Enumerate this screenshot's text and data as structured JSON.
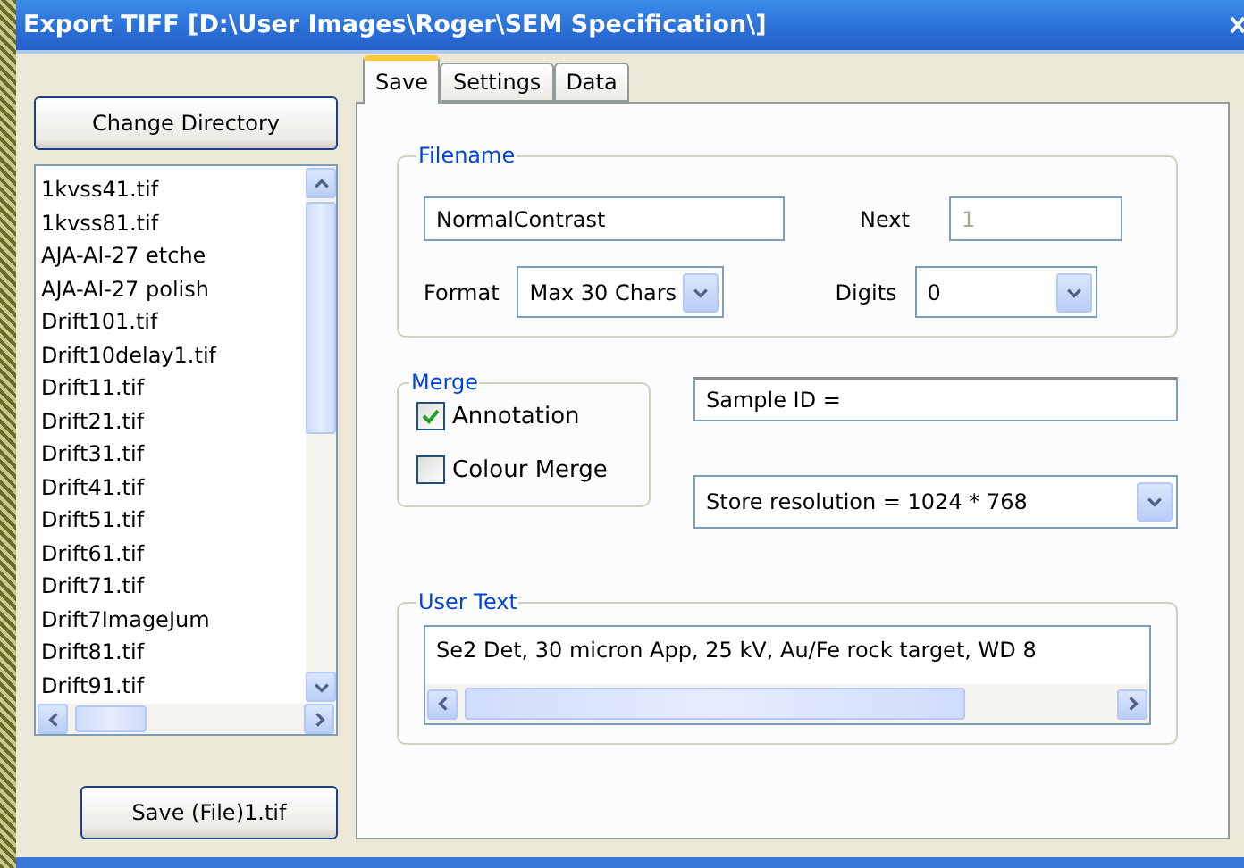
{
  "window": {
    "title": "Export TIFF [D:\\User Images\\Roger\\SEM Specification\\]"
  },
  "change_directory_button": "Change Directory",
  "files": [
    {
      "name": "1kvss41.tif",
      "selected": false
    },
    {
      "name": "1kvss81.tif",
      "selected": false
    },
    {
      "name": "AJA-Al-27 etche",
      "selected": false
    },
    {
      "name": "AJA-Al-27 polish",
      "selected": false
    },
    {
      "name": "Drift101.tif",
      "selected": false
    },
    {
      "name": "Drift10delay1.tif",
      "selected": false
    },
    {
      "name": "Drift11.tif",
      "selected": false
    },
    {
      "name": "Drift21.tif",
      "selected": false
    },
    {
      "name": "Drift31.tif",
      "selected": false
    },
    {
      "name": "Drift41.tif",
      "selected": false
    },
    {
      "name": "Drift51.tif",
      "selected": false
    },
    {
      "name": "Drift61.tif",
      "selected": false
    },
    {
      "name": "Drift71.tif",
      "selected": false
    },
    {
      "name": "Drift7ImageJum",
      "selected": false
    },
    {
      "name": "Drift81.tif",
      "selected": false
    },
    {
      "name": "Drift91.tif",
      "selected": false
    }
  ],
  "save_button": "Save (File)1.tif",
  "tabs": [
    {
      "label": "Save",
      "selected": true
    },
    {
      "label": "Settings",
      "selected": false
    },
    {
      "label": "Data",
      "selected": false
    }
  ],
  "filename": {
    "title": "Filename",
    "value": "NormalContrast",
    "next_label": "Next",
    "next_value": "1",
    "next_disabled": true,
    "format_label": "Format",
    "format_value": "Max 30 Chars",
    "digits_label": "Digits",
    "digits_value": "0"
  },
  "merge": {
    "title": "Merge",
    "options": [
      {
        "label": "Annotation",
        "checked": true
      },
      {
        "label": "Colour Merge",
        "checked": false
      }
    ]
  },
  "sample_id": {
    "value": "Sample ID ="
  },
  "resolution": {
    "value": "Store resolution = 1024 * 768"
  },
  "user_text": {
    "title": "User Text",
    "value": "Se2 Det, 30 micron App,  25 kV, Au/Fe rock target, WD 8"
  }
}
